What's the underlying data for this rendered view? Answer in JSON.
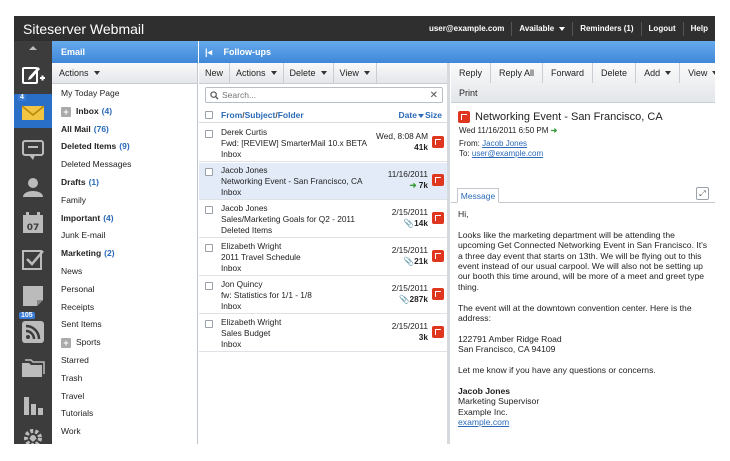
{
  "topbar": {
    "title": "Siteserver Webmail",
    "user": "user@example.com",
    "status": "Available",
    "reminders": "Reminders (1)",
    "logout": "Logout",
    "help": "Help"
  },
  "rail": {
    "items": [
      "compose-icon",
      "mail-icon",
      "chat-icon",
      "contacts-icon",
      "calendar-icon",
      "tasks-icon",
      "notes-icon",
      "rss-icon",
      "files-icon",
      "reports-icon",
      "settings-icon"
    ],
    "mail_badge": "4",
    "calendar_day": "07",
    "rss_badge": "105"
  },
  "email_panel": {
    "header": "Email",
    "actions_label": "Actions",
    "folders": [
      {
        "label": "My Today Page",
        "count": "",
        "bold": false,
        "expand": false
      },
      {
        "label": "Inbox",
        "count": "(4)",
        "bold": true,
        "expand": true
      },
      {
        "label": "All Mail",
        "count": "(76)",
        "bold": true,
        "expand": false
      },
      {
        "label": "Deleted Items",
        "count": "(9)",
        "bold": true,
        "expand": false
      },
      {
        "label": "Deleted Messages",
        "count": "",
        "bold": false,
        "expand": false
      },
      {
        "label": "Drafts",
        "count": "(1)",
        "bold": true,
        "expand": false
      },
      {
        "label": "Family",
        "count": "",
        "bold": false,
        "expand": false
      },
      {
        "label": "Important",
        "count": "(4)",
        "bold": true,
        "expand": false
      },
      {
        "label": "Junk E-mail",
        "count": "",
        "bold": false,
        "expand": false
      },
      {
        "label": "Marketing",
        "count": "(2)",
        "bold": true,
        "expand": false
      },
      {
        "label": "News",
        "count": "",
        "bold": false,
        "expand": false
      },
      {
        "label": "Personal",
        "count": "",
        "bold": false,
        "expand": false
      },
      {
        "label": "Receipts",
        "count": "",
        "bold": false,
        "expand": false
      },
      {
        "label": "Sent Items",
        "count": "",
        "bold": false,
        "expand": false
      },
      {
        "label": "Sports",
        "count": "",
        "bold": false,
        "expand": true
      },
      {
        "label": "Starred",
        "count": "",
        "bold": false,
        "expand": false
      },
      {
        "label": "Trash",
        "count": "",
        "bold": false,
        "expand": false
      },
      {
        "label": "Travel",
        "count": "",
        "bold": false,
        "expand": false
      },
      {
        "label": "Tutorials",
        "count": "",
        "bold": false,
        "expand": false
      },
      {
        "label": "Work",
        "count": "",
        "bold": false,
        "expand": false
      }
    ]
  },
  "list_panel": {
    "header": "Follow-ups",
    "toolbar": {
      "new": "New",
      "actions": "Actions",
      "delete": "Delete",
      "view": "View"
    },
    "search_placeholder": "Search...",
    "columns": {
      "from": "From",
      "subject": "Subject",
      "folder": "Folder",
      "sep": "/",
      "date": "Date",
      "size": "Size"
    },
    "messages": [
      {
        "from": "Derek Curtis",
        "subject": "Fwd: [REVIEW] SmarterMail 10.x BETA",
        "folder": "Inbox",
        "date": "Wed, 8:08 AM",
        "size": "41k",
        "selected": false,
        "icon": ""
      },
      {
        "from": "Jacob Jones",
        "subject": "Networking Event - San Francisco, CA",
        "folder": "Inbox",
        "date": "11/16/2011",
        "size": "7k",
        "selected": true,
        "icon": "forward"
      },
      {
        "from": "Jacob Jones",
        "subject": "Sales/Marketing Goals for Q2 - 2011",
        "folder": "Deleted Items",
        "date": "2/15/2011",
        "size": "14k",
        "selected": false,
        "icon": "attachment"
      },
      {
        "from": "Elizabeth Wright",
        "subject": "2011 Travel Schedule",
        "folder": "Inbox",
        "date": "2/15/2011",
        "size": "21k",
        "selected": false,
        "icon": "attachment"
      },
      {
        "from": "Jon Quincy",
        "subject": "fw: Statistics for 1/1 - 1/8",
        "folder": "Inbox",
        "date": "2/15/2011",
        "size": "287k",
        "selected": false,
        "icon": "attachment"
      },
      {
        "from": "Elizabeth Wright",
        "subject": "Sales Budget",
        "folder": "Inbox",
        "date": "2/15/2011",
        "size": "3k",
        "selected": false,
        "icon": ""
      }
    ]
  },
  "reading_pane": {
    "toolbar": {
      "reply": "Reply",
      "reply_all": "Reply All",
      "forward": "Forward",
      "delete": "Delete",
      "add": "Add",
      "view": "View",
      "print": "Print"
    },
    "subject": "Networking Event - San Francisco, CA",
    "date": "Wed 11/16/2011 6:50 PM",
    "from_label": "From:",
    "from": "Jacob Jones",
    "to_label": "To:",
    "to": "user@example.com",
    "tab": "Message",
    "greeting": "Hi,",
    "para1": "Looks like the marketing department will be attending the upcoming Get Connected Networking Event in San Francisco. It's a three day event that starts on 13th. We will be flying out to this event instead of our usual carpool.  We will also not be setting up our booth this time around, will be more of a meet and greet type thing.",
    "para2": "The event will at the downtown convention center. Here is the address:",
    "addr1": "122791 Amber Ridge Road",
    "addr2": "San Francisco, CA  94109",
    "para3": "Let me know if you have any questions or concerns.",
    "sig_name": "Jacob Jones",
    "sig_title": "Marketing Supervisor",
    "sig_company": "Example Inc.",
    "sig_link": "example.com"
  },
  "colors": {
    "accent": "#3f88d8",
    "flag": "#e0351f",
    "link": "#2a6ab8",
    "forward_arrow": "#3a9b3a"
  }
}
